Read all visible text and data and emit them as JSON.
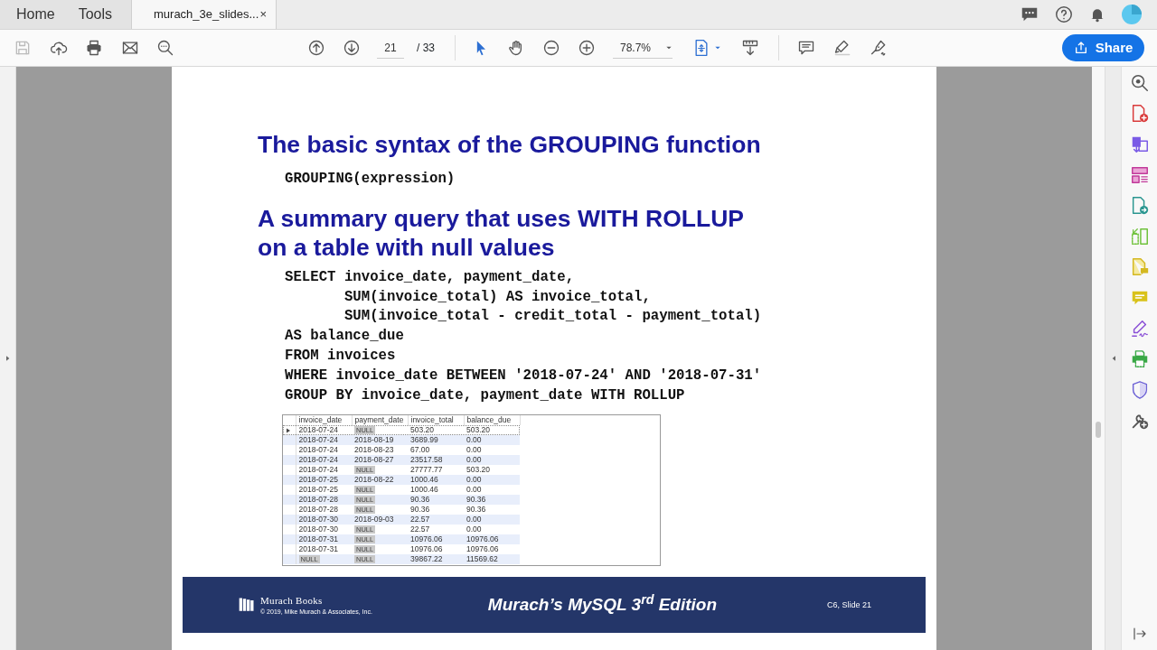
{
  "nav_tabs": [
    {
      "label": "Home",
      "selected": false
    },
    {
      "label": "Tools",
      "selected": false
    }
  ],
  "document_tab": {
    "title": "murach_3e_slides...",
    "close": "×"
  },
  "toolbar": {
    "page_current": "21",
    "page_total": "/ 33",
    "zoom": "78.7%",
    "share": "Share"
  },
  "slide": {
    "heading_1": "The basic syntax of the GROUPING function",
    "code_1": [
      "GROUPING(expression)"
    ],
    "heading_2": [
      "A summary query that uses WITH ROLLUP",
      "on a table with null values"
    ],
    "code_2": [
      "SELECT invoice_date, payment_date,",
      "       SUM(invoice_total) AS invoice_total,",
      "       SUM(invoice_total - credit_total - payment_total)",
      "AS balance_due",
      "FROM invoices",
      "WHERE invoice_date BETWEEN '2018-07-24' AND '2018-07-31'",
      "GROUP BY invoice_date, payment_date WITH ROLLUP"
    ],
    "result_table": {
      "columns": [
        "invoice_date",
        "payment_date",
        "invoice_total",
        "balance_due"
      ],
      "rows": [
        {
          "selected": true,
          "cells": [
            "2018-07-24",
            {
              "kind": "null",
              "text": "NULL"
            },
            "503.20",
            "503.20"
          ]
        },
        {
          "selected": false,
          "cells": [
            "2018-07-24",
            "2018-08-19",
            "3689.99",
            "0.00"
          ]
        },
        {
          "selected": false,
          "cells": [
            "2018-07-24",
            "2018-08-23",
            "67.00",
            "0.00"
          ]
        },
        {
          "selected": false,
          "cells": [
            "2018-07-24",
            "2018-08-27",
            "23517.58",
            "0.00"
          ]
        },
        {
          "selected": false,
          "cells": [
            "2018-07-24",
            {
              "kind": "null",
              "text": "NULL"
            },
            "27777.77",
            "503.20"
          ]
        },
        {
          "selected": false,
          "cells": [
            "2018-07-25",
            "2018-08-22",
            "1000.46",
            "0.00"
          ]
        },
        {
          "selected": false,
          "cells": [
            "2018-07-25",
            {
              "kind": "null",
              "text": "NULL"
            },
            "1000.46",
            "0.00"
          ]
        },
        {
          "selected": false,
          "cells": [
            "2018-07-28",
            {
              "kind": "null",
              "text": "NULL"
            },
            "90.36",
            "90.36"
          ]
        },
        {
          "selected": false,
          "cells": [
            "2018-07-28",
            {
              "kind": "null",
              "text": "NULL"
            },
            "90.36",
            "90.36"
          ]
        },
        {
          "selected": false,
          "cells": [
            "2018-07-30",
            "2018-09-03",
            "22.57",
            "0.00"
          ]
        },
        {
          "selected": false,
          "cells": [
            "2018-07-30",
            {
              "kind": "null",
              "text": "NULL"
            },
            "22.57",
            "0.00"
          ]
        },
        {
          "selected": false,
          "cells": [
            "2018-07-31",
            {
              "kind": "null",
              "text": "NULL"
            },
            "10976.06",
            "10976.06"
          ]
        },
        {
          "selected": false,
          "cells": [
            "2018-07-31",
            {
              "kind": "null",
              "text": "NULL"
            },
            "10976.06",
            "10976.06"
          ]
        },
        {
          "selected": false,
          "cells": [
            {
              "kind": "null",
              "text": "NULL"
            },
            {
              "kind": "null",
              "text": "NULL"
            },
            "39867.22",
            "11569.62"
          ]
        }
      ]
    },
    "footer": {
      "brand": "Murach Books",
      "copyright": "© 2019, Mike Murach & Associates, Inc.",
      "book_title": "Murach’s MySQL 3$^{rd}$ Edition",
      "slide_ref": "C6, Slide 21"
    }
  }
}
